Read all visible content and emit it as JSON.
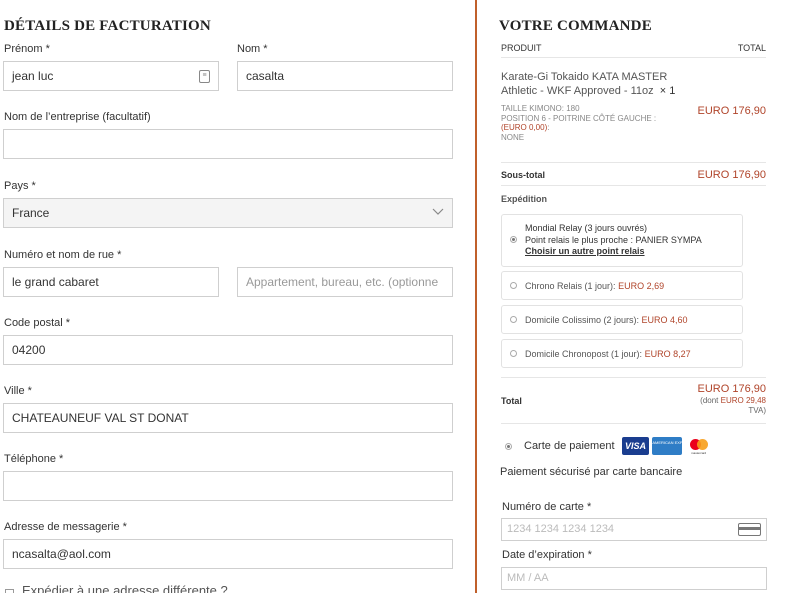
{
  "billing": {
    "title": "DÉTAILS DE FACTURATION",
    "first_name_label": "Prénom *",
    "first_name_value": "jean luc",
    "last_name_label": "Nom *",
    "last_name_value": "casalta",
    "company_label": "Nom de l’entreprise (facultatif)",
    "company_value": "",
    "country_label": "Pays *",
    "country_value": "France",
    "street_label": "Numéro et nom de rue *",
    "street_value": "le grand cabaret",
    "street2_placeholder": "Appartement, bureau, etc. (optionne",
    "postcode_label": "Code postal *",
    "postcode_value": "04200",
    "city_label": "Ville *",
    "city_value": "CHATEAUNEUF VAL ST DONAT",
    "phone_label": "Téléphone *",
    "phone_value": "",
    "email_label": "Adresse de messagerie *",
    "email_value": "ncasalta@aol.com",
    "ship_different_label": "Expédier à une adresse différente ?"
  },
  "order": {
    "title": "VOTRE COMMANDE",
    "col_product": "PRODUIT",
    "col_total": "TOTAL",
    "item_name_line1": "Karate-Gi Tokaido KATA MASTER",
    "item_name_line2": "Athletic - WKF Approved - 11oz",
    "item_qty": "× 1",
    "item_meta_size": "TAILLE KIMONO:  180",
    "item_meta_position": "POSITION 6 - POITRINE CÔTÉ GAUCHE :",
    "item_meta_position_price": "(EURO 0,00)",
    "item_meta_position_suffix": ":",
    "item_meta_none": "NONE",
    "item_price": "EURO 176,90",
    "subtotal_label": "Sous-total",
    "subtotal_value": "EURO 176,90",
    "shipping_label": "Expédition",
    "shipping_options": [
      {
        "line1": "Mondial Relay (3 jours ouvrés)",
        "line2": "Point relais le plus proche : PANIER SYMPA",
        "link": "Choisir un autre point relais",
        "selected": true
      },
      {
        "label": "Chrono Relais (1 jour):",
        "price": "EURO 2,69",
        "selected": false
      },
      {
        "label": "Domicile Colissimo (2 jours):",
        "price": "EURO 4,60",
        "selected": false
      },
      {
        "label": "Domicile Chronopost (1 jour):",
        "price": "EURO 8,27",
        "selected": false
      }
    ],
    "total_label": "Total",
    "total_value": "EURO 176,90",
    "total_tax_prefix": "(dont",
    "total_tax_value": "EURO 29,48",
    "total_tax_suffix": "TVA)"
  },
  "payment": {
    "method_label": "Carte de paiement",
    "card_logos": [
      "VISA",
      "AMERICAN EXPRESS",
      "mastercard"
    ],
    "description": "Paiement sécurisé par carte bancaire",
    "card_number_label": "Numéro de carte *",
    "card_number_placeholder": "1234 1234 1234 1234",
    "expiry_label": "Date d’expiration *",
    "expiry_placeholder": "MM / AA"
  },
  "colors": {
    "accent": "#c0602b",
    "price": "#b0442a"
  }
}
